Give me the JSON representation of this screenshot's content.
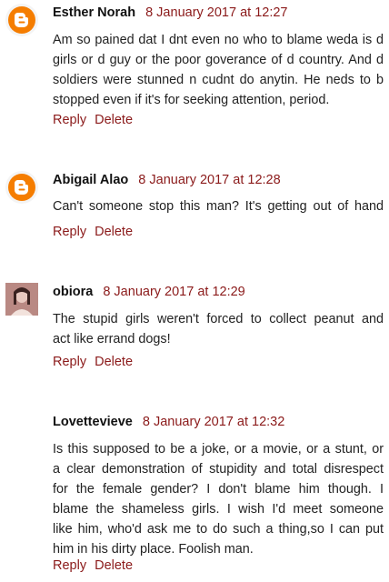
{
  "comments": [
    {
      "author": "Esther Norah",
      "timestamp": "8 January 2017 at 12:27",
      "avatar": "blogger-logo-icon",
      "lines": [
        "Am so pained dat I dnt even no who to blame weda is d",
        "girls or d guy or the poor goverance of d country. And d",
        "soldiers were stunned n cudnt do anytin. He neds to b",
        "stopped even if it's for seeking attention, period."
      ],
      "reply_label": "Reply",
      "delete_label": "Delete"
    },
    {
      "author": "Abigail Alao",
      "timestamp": "8 January 2017 at 12:28",
      "avatar": "blogger-logo-icon",
      "lines": [
        "Can't someone stop this man? It's getting out of hand"
      ],
      "reply_label": "Reply",
      "delete_label": "Delete"
    },
    {
      "author": "obiora",
      "timestamp": "8 January 2017 at 12:29",
      "avatar": "user-photo",
      "lines": [
        "The stupid girls weren't forced to collect peanut and",
        "act like errand dogs!"
      ],
      "reply_label": "Reply",
      "delete_label": "Delete"
    },
    {
      "author": "Lovettevieve",
      "timestamp": "8 January 2017 at 12:32",
      "avatar": "none",
      "lines": [
        "Is this supposed to be a joke, or a movie, or a stunt, or",
        "a clear demonstration of stupidity and total disrespect",
        "for the female gender? I don't blame him though. I",
        "blame the shameless girls. I wish I'd meet someone",
        "like him, who'd ask me to do such a thing,so I can put",
        "him in his dirty place. Foolish man."
      ],
      "reply_label": "Reply",
      "delete_label": "Delete"
    }
  ],
  "colors": {
    "link": "#8b1a1a",
    "blogger_orange": "#f57d00"
  }
}
